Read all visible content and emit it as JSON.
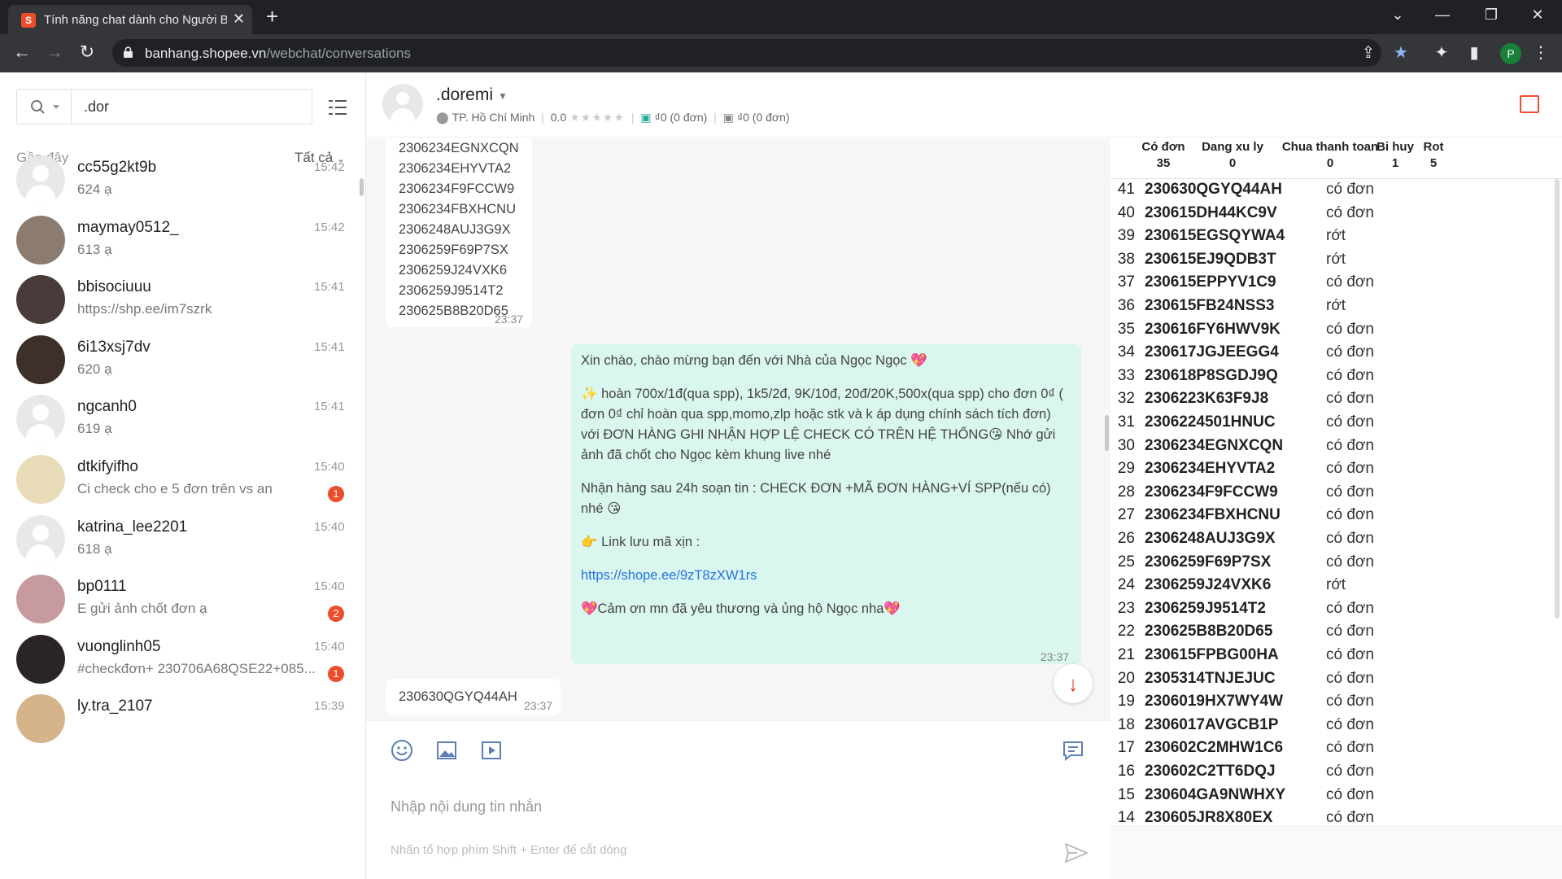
{
  "browser": {
    "tab_title": "Tính năng chat dành cho Người B",
    "url_domain": "banhang.shopee.vn",
    "url_path": "/webchat/conversations",
    "profile_initial": "P"
  },
  "sidebar": {
    "search_value": ".dor",
    "recent_label": "Gần đây",
    "filter_label": "Tất cả",
    "conversations": [
      {
        "name": "cc55g2kt9b",
        "preview": "624 ạ",
        "time": "15:42",
        "badge": ""
      },
      {
        "name": "maymay0512_",
        "preview": "613 ạ",
        "time": "15:42",
        "badge": ""
      },
      {
        "name": "bbisociuuu",
        "preview": "https://shp.ee/im7szrk",
        "time": "15:41",
        "badge": ""
      },
      {
        "name": "6i13xsj7dv",
        "preview": "620 ạ",
        "time": "15:41",
        "badge": ""
      },
      {
        "name": "ngcanh0",
        "preview": "619 ạ",
        "time": "15:41",
        "badge": ""
      },
      {
        "name": "dtkifyifho",
        "preview": "Ci check cho e 5 đơn trên vs an",
        "time": "15:40",
        "badge": "1"
      },
      {
        "name": "katrina_lee2201",
        "preview": "618 ạ",
        "time": "15:40",
        "badge": ""
      },
      {
        "name": "bp0111",
        "preview": "E gửi ảnh chốt đơn ạ",
        "time": "15:40",
        "badge": "2"
      },
      {
        "name": "vuonglinh05",
        "preview": "#checkđơn+ 230706A68QSE22+085...",
        "time": "15:40",
        "badge": "1"
      },
      {
        "name": "ly.tra_2107",
        "preview": "",
        "time": "15:39",
        "badge": ""
      }
    ]
  },
  "chat_header": {
    "name": ".doremi",
    "location": "TP. Hồ Chí Minh",
    "rating": "0.0",
    "stars": "★★★★★",
    "orders_done": "₫0 (0 đơn)",
    "orders_cancel": "₫0 (0 đơn)"
  },
  "messages": {
    "incoming_orders": [
      "2306234EGNXCQN",
      "2306234EHYVTA2",
      "2306234F9FCCW9",
      "2306234FBXHCNU",
      "2306248AUJ3G9X",
      "2306259F69P7SX",
      "2306259J24VXK6",
      "2306259J9514T2",
      "230625B8B20D65"
    ],
    "incoming_time": "23:37",
    "outgoing_lines": [
      "Xin chào, chào mừng bạn đến với Nhà của Ngọc Ngọc 💖",
      "",
      "✨ hoàn 700x/1đ(qua spp), 1k5/2đ, 9K/10đ, 20đ/20K,500x(qua spp) cho đơn 0₫ ( đơn 0₫ chỉ hoàn qua spp,momo,zlp hoặc stk và k áp dụng chính sách tích đơn) với ĐƠN HÀNG GHI NHẬN HỢP LỆ CHECK CÓ TRÊN HỆ THỐNG😘 Nhớ gửi ảnh đã chốt cho Ngọc kèm khung live nhé",
      "",
      "Nhận hàng sau 24h soạn tin : CHECK ĐƠN +MÃ ĐƠN HÀNG+VÍ SPP(nếu có) nhé 😘",
      "",
      "👉 Link lưu mã xịn :",
      "",
      "https://shope.ee/9zT8zXW1rs",
      "",
      "💖Cảm ơn mn đã yêu thương và ủng hộ Ngọc nha💖"
    ],
    "outgoing_time": "23:37",
    "last_incoming": "230630QGYQ44AH",
    "last_time": "23:37"
  },
  "composer": {
    "placeholder": "Nhập nội dung tin nhắn",
    "hint": "Nhấn tổ hợp phím Shift + Enter để cắt dòng"
  },
  "panel": {
    "headers": [
      {
        "label": "Có đơn",
        "value": "35"
      },
      {
        "label": "Dang xu ly",
        "value": "0"
      },
      {
        "label": "Chua thanh toan",
        "value": "0"
      },
      {
        "label": "Bi huy",
        "value": "1"
      },
      {
        "label": "Rot",
        "value": "5"
      }
    ],
    "rows": [
      {
        "n": "41",
        "code": "230630QGYQ44AH",
        "status": "có đơn"
      },
      {
        "n": "40",
        "code": "230615DH44KC9V",
        "status": "có đơn"
      },
      {
        "n": "39",
        "code": "230615EGSQYWA4",
        "status": "rớt"
      },
      {
        "n": "38",
        "code": "230615EJ9QDB3T",
        "status": "rớt"
      },
      {
        "n": "37",
        "code": "230615EPPYV1C9",
        "status": "có đơn"
      },
      {
        "n": "36",
        "code": "230615FB24NSS3",
        "status": "rớt"
      },
      {
        "n": "35",
        "code": "230616FY6HWV9K",
        "status": "có đơn"
      },
      {
        "n": "34",
        "code": "230617JGJEEGG4",
        "status": "có đơn"
      },
      {
        "n": "33",
        "code": "230618P8SGDJ9Q",
        "status": "có đơn"
      },
      {
        "n": "32",
        "code": "2306223K63F9J8",
        "status": "có đơn"
      },
      {
        "n": "31",
        "code": "2306224501HNUC",
        "status": "có đơn"
      },
      {
        "n": "30",
        "code": "2306234EGNXCQN",
        "status": "có đơn"
      },
      {
        "n": "29",
        "code": "2306234EHYVTA2",
        "status": "có đơn"
      },
      {
        "n": "28",
        "code": "2306234F9FCCW9",
        "status": "có đơn"
      },
      {
        "n": "27",
        "code": "2306234FBXHCNU",
        "status": "có đơn"
      },
      {
        "n": "26",
        "code": "2306248AUJ3G9X",
        "status": "có đơn"
      },
      {
        "n": "25",
        "code": "2306259F69P7SX",
        "status": "có đơn"
      },
      {
        "n": "24",
        "code": "2306259J24VXK6",
        "status": "rớt"
      },
      {
        "n": "23",
        "code": "2306259J9514T2",
        "status": "có đơn"
      },
      {
        "n": "22",
        "code": "230625B8B20D65",
        "status": "có đơn"
      },
      {
        "n": "21",
        "code": "230615FPBG00HA",
        "status": "có đơn"
      },
      {
        "n": "20",
        "code": "2305314TNJEJUC",
        "status": "có đơn"
      },
      {
        "n": "19",
        "code": "2306019HX7WY4W",
        "status": "có đơn"
      },
      {
        "n": "18",
        "code": "2306017AVGCB1P",
        "status": "có đơn"
      },
      {
        "n": "17",
        "code": "230602C2MHW1C6",
        "status": "có đơn"
      },
      {
        "n": "16",
        "code": "230602C2TT6DQJ",
        "status": "có đơn"
      },
      {
        "n": "15",
        "code": "230604GA9NWHXY",
        "status": "có đơn"
      },
      {
        "n": "14",
        "code": "230605JR8X80EX",
        "status": "có đơn"
      }
    ]
  },
  "colors": {
    "accent": "#ee4d2d",
    "outgoing_bubble": "#d9f6ef",
    "link": "#2673dd"
  }
}
